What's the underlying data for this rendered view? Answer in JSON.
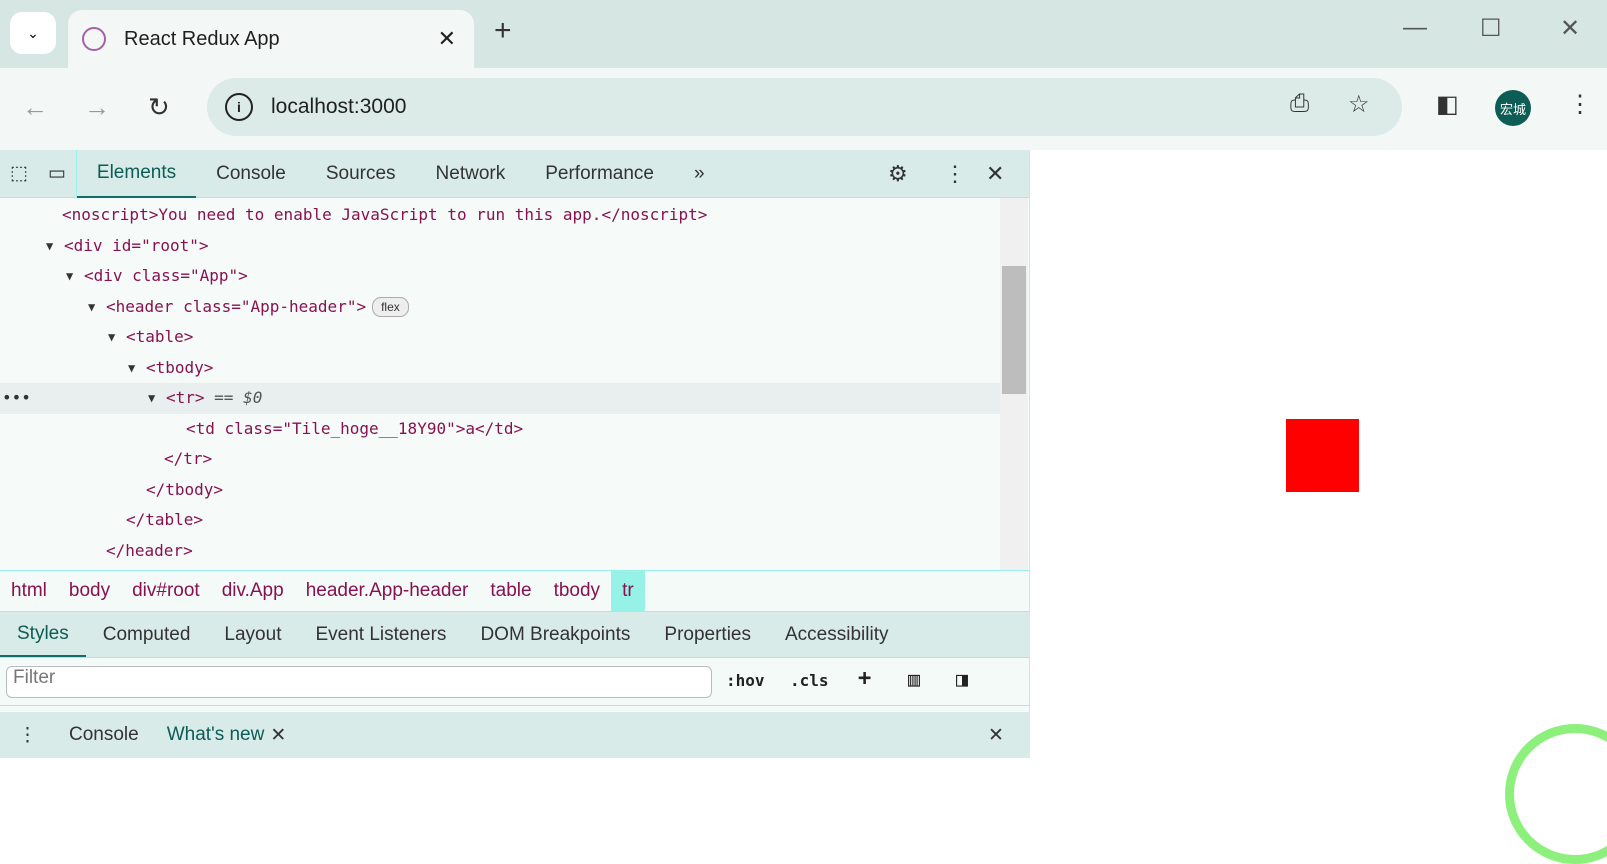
{
  "browser": {
    "tab_title": "React Redux App",
    "url": "localhost:3000",
    "profile_initials": "宏城"
  },
  "devtools": {
    "tabs": [
      "Elements",
      "Console",
      "Sources",
      "Network",
      "Performance"
    ],
    "code_lines": [
      {
        "pre": "  ",
        "html": "noscript",
        "text": "<noscript>You need to enable JavaScript to run this app.</noscript>"
      },
      {
        "text": "<div id=\"root\">"
      },
      {
        "text": "<div class=\"App\">"
      },
      {
        "text": "<header class=\"App-header\">",
        "badge": "flex"
      },
      {
        "text": "<table>"
      },
      {
        "text": "<tbody>"
      },
      {
        "text": "<tr>",
        "suffix": " == $0"
      },
      {
        "text": "<td class=\"Tile_hoge__18Y90\">a</td>"
      },
      {
        "text": "</tr>"
      },
      {
        "text": "</tbody>"
      },
      {
        "text": "</table>"
      },
      {
        "text": "</header>"
      }
    ],
    "breadcrumbs": [
      "html",
      "body",
      "div#root",
      "div.App",
      "header.App-header",
      "table",
      "tbody",
      "tr"
    ],
    "styles_tabs": [
      "Styles",
      "Computed",
      "Layout",
      "Event Listeners",
      "DOM Breakpoints",
      "Properties",
      "Accessibility"
    ],
    "filter_placeholder": "Filter",
    "hov": ":hov",
    "cls": ".cls",
    "drawer_tabs": [
      "Console",
      "What's new"
    ]
  }
}
